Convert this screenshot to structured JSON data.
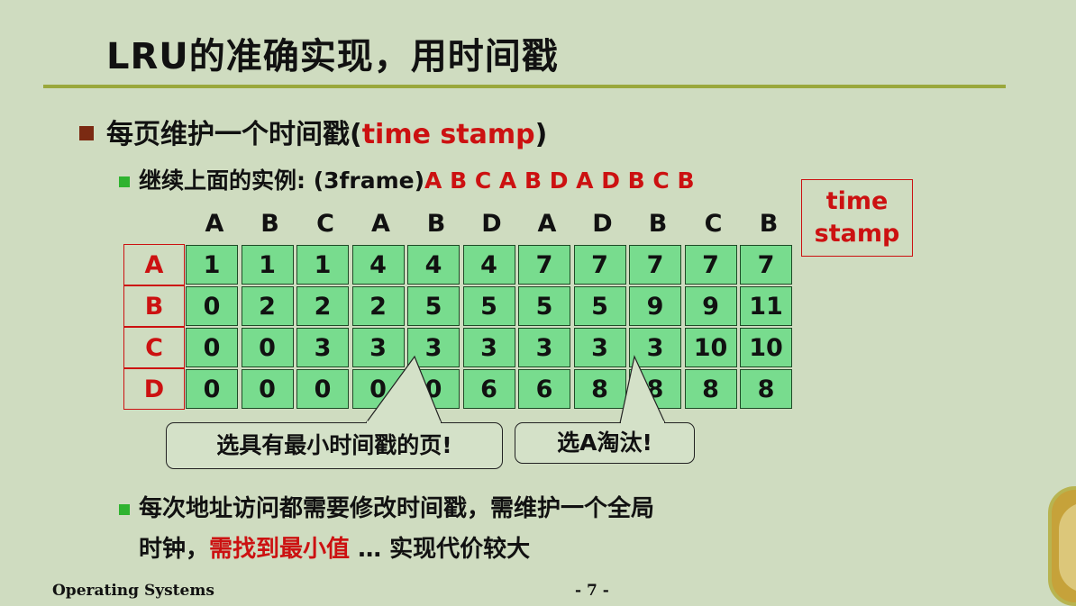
{
  "title": "LRU的准确实现，用时间戳",
  "bullet1": {
    "prefix": "每页维护一个时间戳(",
    "red": "time stamp",
    "suffix": ")"
  },
  "bullet2": {
    "prefix": "继续上面的实例: (3frame)",
    "red": "A B C A B D A D B C B"
  },
  "stamp_label": {
    "line1": "time",
    "line2": "stamp"
  },
  "table": {
    "columns": [
      "A",
      "B",
      "C",
      "A",
      "B",
      "D",
      "A",
      "D",
      "B",
      "C",
      "B"
    ],
    "rows": [
      {
        "label": "A",
        "values": [
          "1",
          "1",
          "1",
          "4",
          "4",
          "4",
          "7",
          "7",
          "7",
          "7",
          "7"
        ]
      },
      {
        "label": "B",
        "values": [
          "0",
          "2",
          "2",
          "2",
          "5",
          "5",
          "5",
          "5",
          "9",
          "9",
          "11"
        ]
      },
      {
        "label": "C",
        "values": [
          "0",
          "0",
          "3",
          "3",
          "3",
          "3",
          "3",
          "3",
          "3",
          "10",
          "10"
        ]
      },
      {
        "label": "D",
        "values": [
          "0",
          "0",
          "0",
          "0",
          "0",
          "6",
          "6",
          "8",
          "8",
          "8",
          "8"
        ]
      }
    ]
  },
  "callouts": {
    "left": "选具有最小时间戳的页!",
    "right_prefix": "选",
    "right_bold": "A",
    "right_suffix": "淘汰!"
  },
  "bullet3": {
    "line1": "每次地址访问都需要修改时间戳，需维护一个全局",
    "line2_prefix": "时钟，",
    "line2_red": "需找到最小值",
    "line2_suffix": " … 实现代价较大"
  },
  "footer": {
    "left": "Operating Systems",
    "center": "- 7 -"
  }
}
